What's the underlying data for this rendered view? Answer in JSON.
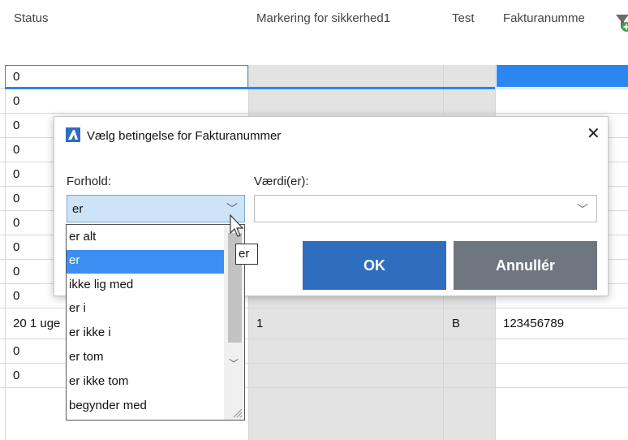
{
  "header": {
    "columns": {
      "status": "Status",
      "marking": "Markering for sikkerhed1",
      "test": "Test",
      "invoice": "Fakturanumme"
    },
    "filter_icon": "filter-add-icon"
  },
  "grid": {
    "rows": [
      {
        "status": "0"
      },
      {
        "status": "0"
      },
      {
        "status": "0"
      },
      {
        "status": "0"
      },
      {
        "status": "0"
      },
      {
        "status": "0"
      },
      {
        "status": "0"
      },
      {
        "status": "0"
      },
      {
        "status": "0"
      },
      {
        "status": "0"
      },
      {
        "status": "20 1 uge",
        "marking": "1",
        "test": "B",
        "invoice": "123456789"
      },
      {
        "status": "0"
      },
      {
        "status": "0"
      }
    ]
  },
  "dialog": {
    "title": "Vælg betingelse for Fakturanummer",
    "close_icon": "close-icon",
    "condition_label": "Forhold:",
    "values_label": "Værdi(er):",
    "condition_value": "er",
    "values_value": "",
    "ok_label": "OK",
    "cancel_label": "Annullér"
  },
  "dropdown": {
    "options": [
      "er alt",
      "er",
      "ikke lig med",
      "er i",
      "er ikke i",
      "er tom",
      "er ikke tom",
      "begynder med"
    ],
    "selected": "er"
  },
  "tooltip": "er",
  "colors": {
    "accent": "#2c86f0",
    "ok_button": "#2f6dbf",
    "cancel_button": "#6e7780",
    "condition_select_bg": "#cde4f7"
  }
}
